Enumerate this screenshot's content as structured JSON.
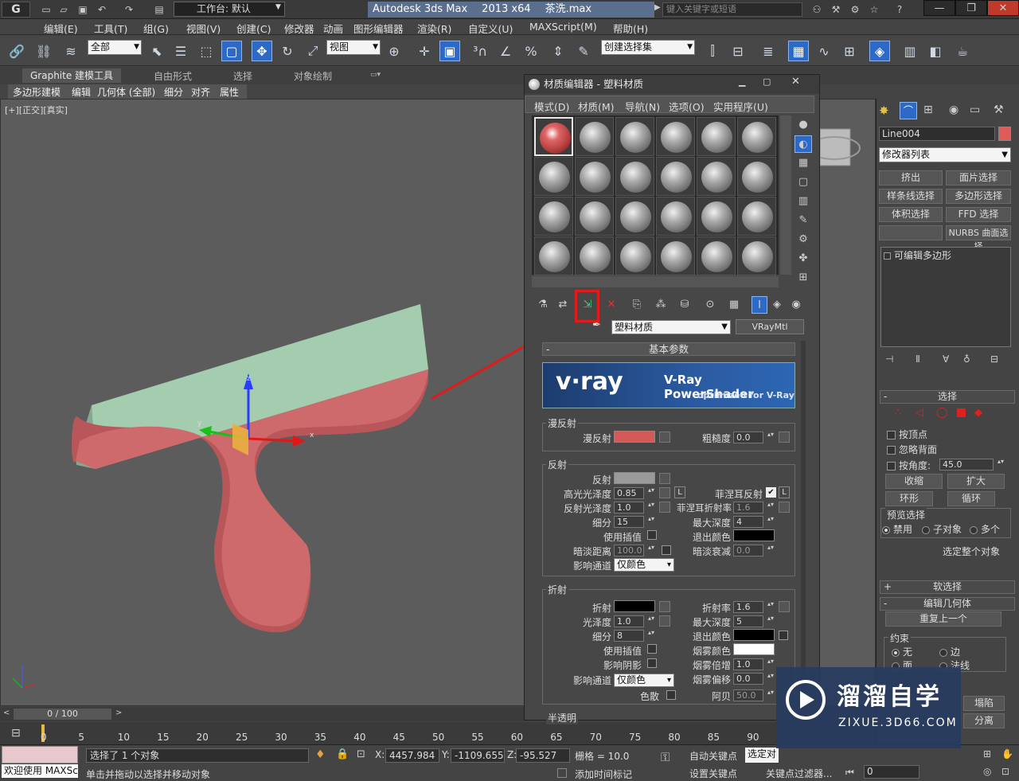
{
  "titlebar": {
    "workspace": "工作台: 默认",
    "app_name": "Autodesk 3ds Max",
    "app_version": "2013 x64",
    "file_name": "茶洗.max",
    "search_placeholder": "键入关键字或短语"
  },
  "menubar": [
    "编辑(E)",
    "工具(T)",
    "组(G)",
    "视图(V)",
    "创建(C)",
    "修改器",
    "动画",
    "图形编辑器",
    "渲染(R)",
    "自定义(U)",
    "MAXScript(M)",
    "帮助(H)"
  ],
  "toolbar": {
    "selection_filter": "全部",
    "ref_coord": "视图",
    "named_selection": "创建选择集"
  },
  "ribbon": {
    "tabs": [
      "Graphite 建模工具",
      "自由形式",
      "选择",
      "对象绘制"
    ],
    "subtabs": [
      "多边形建模",
      "编辑",
      "几何体 (全部)",
      "细分",
      "对齐",
      "属性"
    ]
  },
  "viewport": {
    "label": "[+][正交][真实]"
  },
  "timeline": {
    "frame_display": "0 / 100",
    "ticks": [
      "0",
      "5",
      "10",
      "15",
      "20",
      "25",
      "30",
      "35",
      "40",
      "45",
      "50",
      "55",
      "60",
      "65",
      "70",
      "75",
      "80",
      "85",
      "90"
    ]
  },
  "status": {
    "welcome": "欢迎使用 MAXSc",
    "selected": "选择了 1 个对象",
    "hint": "单击并拖动以选择并移动对象",
    "x_label": "X:",
    "x_value": "4457.984",
    "y_label": "Y:",
    "y_value": "-1109.655",
    "z_label": "Z:",
    "z_value": "-95.527",
    "grid": "栅格 = 10.0",
    "autokey": "自动关键点",
    "selected_obj": "选定对",
    "setkey": "设置关键点",
    "keyfilter": "关键点过滤器...",
    "add_time_tag": "添加时间标记",
    "frame": "0"
  },
  "cmdpanel": {
    "object_name": "Line004",
    "object_color": "#e05a5a",
    "modifier_list": "修改器列表",
    "buttons": [
      "挤出",
      "面片选择",
      "样条线选择",
      "多边形选择",
      "体积选择",
      "FFD 选择",
      "",
      "NURBS 曲面选择"
    ],
    "stack_item": "可编辑多边形",
    "selection_rollout": "选择",
    "by_vertex": "按顶点",
    "ignore_backface": "忽略背面",
    "by_angle": "按角度:",
    "angle_value": "45.0",
    "shrink": "收缩",
    "grow": "扩大",
    "ring": "环形",
    "loop": "循环",
    "preview_label": "预览选择",
    "preview_options": [
      "禁用",
      "子对象",
      "多个"
    ],
    "select_whole": "选定整个对象",
    "soft_selection": "软选择",
    "edit_geometry": "编辑几何体",
    "repeat_last": "重复上一个",
    "constraints": "约束",
    "constraint_options": [
      "无",
      "边",
      "面",
      "法线"
    ],
    "collapse": "塌陷",
    "detach": "分离"
  },
  "mateditor": {
    "title": "材质编辑器 - 塑料材质",
    "menu": [
      "模式(D)",
      "材质(M)",
      "导航(N)",
      "选项(O)",
      "实用程序(U)"
    ],
    "material_name": "塑料材质",
    "material_type": "VRayMtl",
    "basic_params": "基本参数",
    "vray_title": "V-Ray PowerShader",
    "vray_sub": "optimized for V-Ray",
    "vray_logo": "v·ray",
    "diffuse_group": "漫反射",
    "diffuse": "漫反射",
    "diffuse_color": "#d45a5a",
    "roughness": "粗糙度",
    "roughness_value": "0.0",
    "reflection_group": "反射",
    "reflect": "反射",
    "reflect_color": "#9a9a9a",
    "hilight_gloss": "高光光泽度",
    "hilight_value": "0.85",
    "lock": "L",
    "fresnel": "菲涅耳反射",
    "refl_gloss": "反射光泽度",
    "refl_gloss_value": "1.0",
    "fresnel_ior": "菲涅耳折射率",
    "fresnel_ior_value": "1.6",
    "subdivs": "细分",
    "subdivs_value": "15",
    "max_depth": "最大深度",
    "max_depth_value": "4",
    "use_interp": "使用插值",
    "exit_color": "退出颜色",
    "dim_distance": "暗淡距离",
    "dim_distance_value": "100.0",
    "dim_falloff": "暗淡衰减",
    "dim_falloff_value": "0.0",
    "affect_channels": "影响通道",
    "channel_value": "仅颜色",
    "refraction_group": "折射",
    "refract": "折射",
    "refract_ior": "折射率",
    "refract_ior_value": "1.6",
    "glossiness": "光泽度",
    "gloss_value": "1.0",
    "refr_max_depth_value": "5",
    "refr_subdivs_value": "8",
    "fog_color": "烟雾颜色",
    "affect_shadows": "影响阴影",
    "fog_multiplier": "烟雾倍增",
    "fog_mult_value": "1.0",
    "fog_bias": "烟雾偏移",
    "fog_bias_value": "0.0",
    "dispersion": "色散",
    "abbe": "阿贝",
    "abbe_value": "50.0",
    "translucency": "半透明"
  },
  "watermark": {
    "brand": "溜溜自学",
    "url": "ZIXUE.3D66.COM"
  }
}
